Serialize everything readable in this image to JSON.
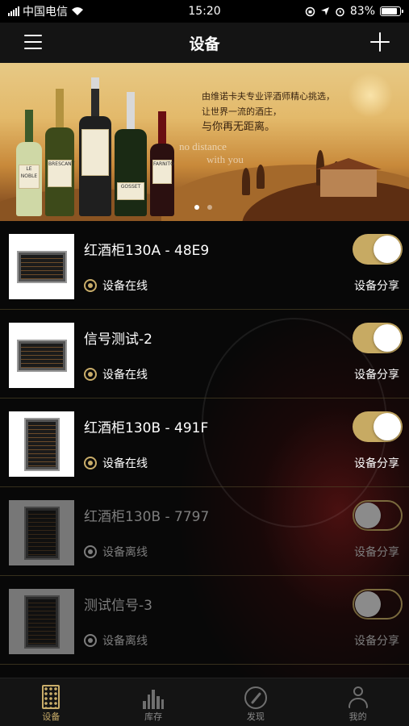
{
  "status_bar": {
    "carrier": "中国电信",
    "time": "15:20",
    "battery": "83%"
  },
  "nav": {
    "title": "设备"
  },
  "banner": {
    "line1": "由维诺卡夫专业评酒师精心挑选，",
    "line2": "让世界一流的酒庄，",
    "line3": "与你再无距离。",
    "faint1": "no distance",
    "faint2": "with you",
    "bottle_labels": [
      "LE NOBLE",
      "BRESCANT",
      "",
      "GOSSET",
      "FARNITO"
    ],
    "active_slide": 0,
    "slide_count": 2
  },
  "devices": [
    {
      "name": "红酒柜130A - 48E9",
      "status": "设备在线",
      "share": "设备分享",
      "online": true,
      "toggle_on": true,
      "cabinet": "wide"
    },
    {
      "name": "信号测试-2",
      "status": "设备在线",
      "share": "设备分享",
      "online": true,
      "toggle_on": true,
      "cabinet": "wide"
    },
    {
      "name": "红酒柜130B - 491F",
      "status": "设备在线",
      "share": "设备分享",
      "online": true,
      "toggle_on": true,
      "cabinet": "tall"
    },
    {
      "name": "红酒柜130B - 7797",
      "status": "设备离线",
      "share": "设备分享",
      "online": false,
      "toggle_on": false,
      "cabinet": "tall"
    },
    {
      "name": "测试信号-3",
      "status": "设备离线",
      "share": "设备分享",
      "online": false,
      "toggle_on": false,
      "cabinet": "tall"
    }
  ],
  "tabs": [
    {
      "label": "设备",
      "icon": "cabinet-icon",
      "active": true
    },
    {
      "label": "库存",
      "icon": "stock-icon",
      "active": false
    },
    {
      "label": "发现",
      "icon": "compass-icon",
      "active": false
    },
    {
      "label": "我的",
      "icon": "user-icon",
      "active": false
    }
  ],
  "colors": {
    "accent": "#c9ad6a",
    "toggle_on": "#c7aa63",
    "background": "#080808",
    "nav_bg": "#141414"
  }
}
